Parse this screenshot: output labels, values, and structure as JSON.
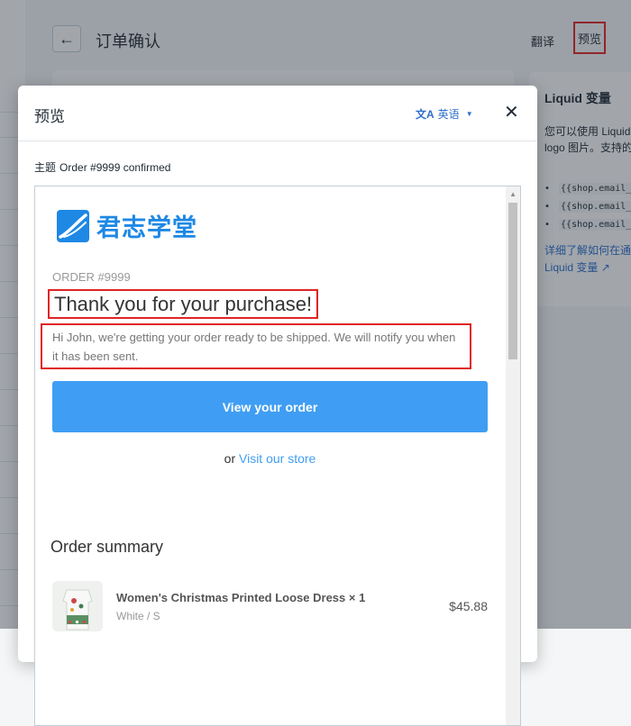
{
  "page": {
    "title": "订单确认",
    "translate_label": "翻译",
    "preview_label": "预览"
  },
  "side_panel": {
    "title": "Liquid 变量",
    "description": "您可以使用 Liquid 变量添加强调色和 logo 图片。支持的变量有：",
    "variables": [
      "{{shop.email_accent_color}}",
      "{{shop.email_logo_url}}",
      "{{shop.email_logo_width}}"
    ],
    "link_text": "详细了解如何在通知模板中使用 Liquid 变量"
  },
  "modal": {
    "title": "预览",
    "language": "英语",
    "subject_label": "主题",
    "subject_value": "Order #9999 confirmed"
  },
  "email": {
    "logo_text": "君志学堂",
    "order_number": "ORDER #9999",
    "heading": "Thank you for your purchase!",
    "intro": "Hi John, we're getting your order ready to be shipped. We will notify you when it has been sent.",
    "button_label": "View your order",
    "visit_prefix": "or",
    "visit_link": "Visit our store",
    "summary_title": "Order summary",
    "items": [
      {
        "name": "Women's Christmas Printed Loose Dress × 1",
        "variant": "White / S",
        "price": "$45.88"
      }
    ]
  },
  "colors": {
    "accent": "#3f9ef3",
    "highlight_border": "#e02424",
    "link": "#2c6ecb"
  },
  "icons": [
    "arrow-left-icon",
    "translate-icon",
    "caret-down-icon",
    "close-icon",
    "external-link-icon"
  ]
}
